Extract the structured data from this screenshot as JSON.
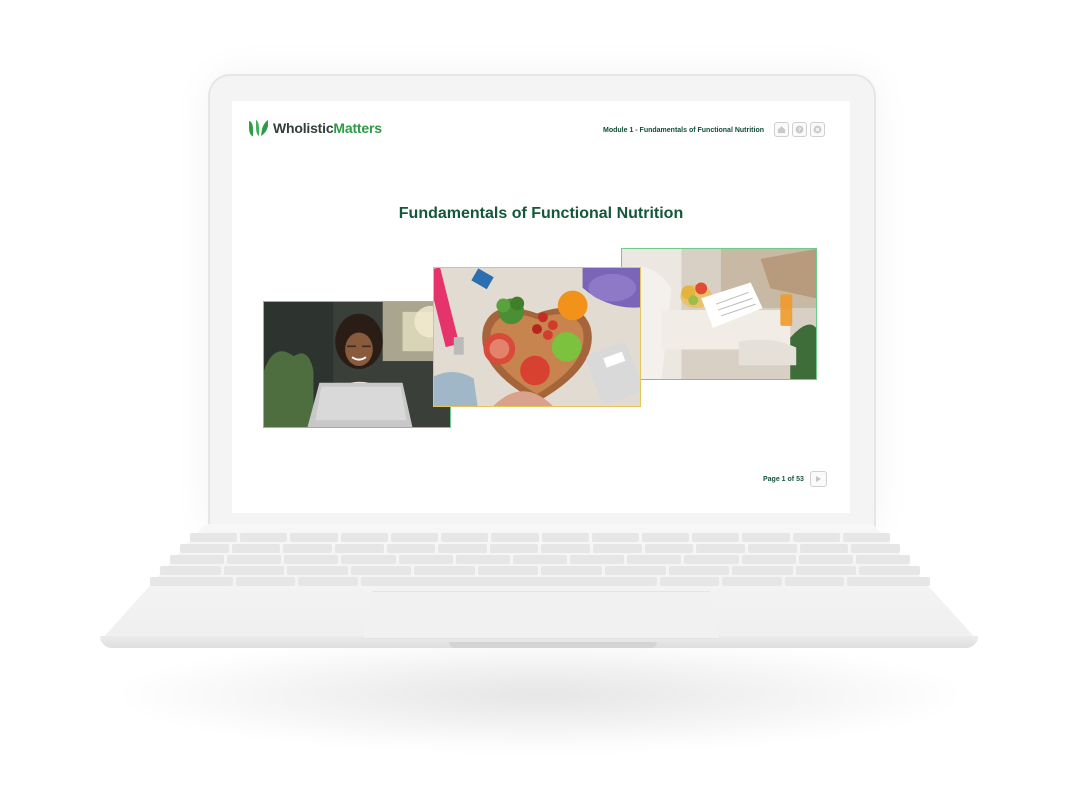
{
  "header": {
    "brand_part1": "Wholistic",
    "brand_part2": "Matters",
    "module_title": "Module 1 - Fundamentals of Functional Nutrition",
    "nav_icons": [
      "home-icon",
      "help-icon",
      "close-icon"
    ]
  },
  "slide": {
    "title": "Fundamentals of Functional Nutrition",
    "images": [
      "woman-at-laptop-photo",
      "heart-bowl-fruit-vegetables-photo",
      "nutritionist-consultation-photo"
    ]
  },
  "pager": {
    "label": "Page 1 of 53",
    "next_icon": "play-icon"
  },
  "colors": {
    "brand_green": "#2f9a48",
    "title_green": "#15573a",
    "frame_green": "#6ccd8a",
    "frame_gold": "#e3c55a"
  }
}
